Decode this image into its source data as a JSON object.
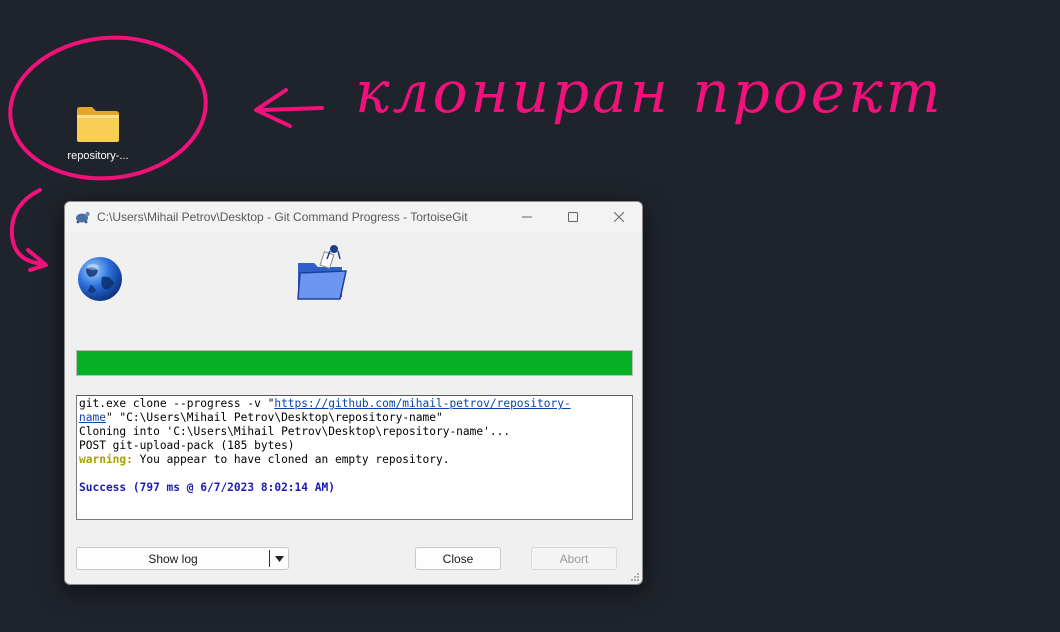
{
  "desktop": {
    "icon_label": "repository-...",
    "annotation": "клониран проект"
  },
  "dialog": {
    "title": "C:\\Users\\Mihail Petrov\\Desktop - Git Command Progress - TortoiseGit",
    "progress_percent": 100,
    "log": {
      "cmd_prefix": "git.exe clone --progress -v \"",
      "url_part1": "https://github.com/mihail-petrov/repository-",
      "url_part2": "name",
      "cmd_suffix": "\" \"C:\\Users\\Mihail Petrov\\Desktop\\repository-name\"",
      "cloning": "Cloning into 'C:\\Users\\Mihail Petrov\\Desktop\\repository-name'...",
      "post": "POST git-upload-pack (185 bytes)",
      "warning_label": "warning:",
      "warning_text": " You appear to have cloned an empty repository.",
      "success": "Success (797 ms @ 6/7/2023 8:02:14 AM)"
    },
    "buttons": {
      "show_log": "Show log",
      "close": "Close",
      "abort": "Abort"
    }
  },
  "colors": {
    "annotation": "#f0127a",
    "progress": "#06b025"
  }
}
